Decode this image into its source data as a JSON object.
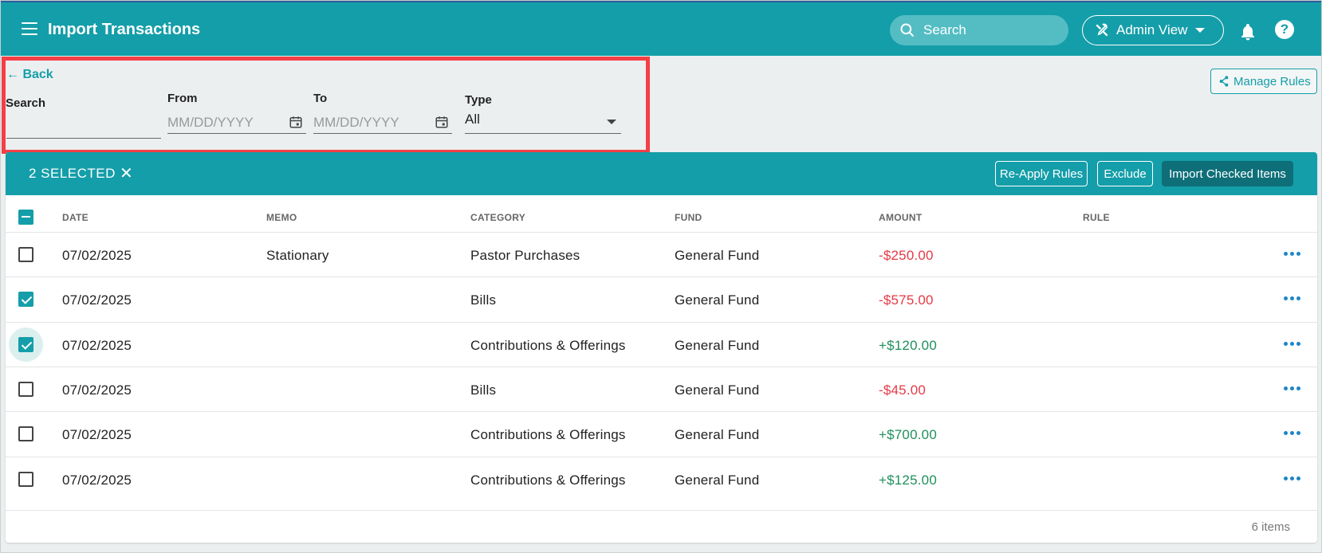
{
  "header": {
    "title": "Import Transactions",
    "search_placeholder": "Search",
    "admin_view_label": "Admin View",
    "help_label": "?",
    "menu_icon": "hamburger-icon",
    "bell_icon": "bell-icon",
    "brand_color": "#149ea9"
  },
  "filters": {
    "back_label": "Back",
    "search_label": "Search",
    "search_value": "",
    "from_label": "From",
    "from_placeholder": "MM/DD/YYYY",
    "to_label": "To",
    "to_placeholder": "MM/DD/YYYY",
    "type_label": "Type",
    "type_value": "All",
    "highlight_color": "#f43f45"
  },
  "manage_rules_label": "Manage Rules",
  "selection_bar": {
    "selected_text": "2 SELECTED",
    "close_glyph": "✕",
    "reapply_label": "Re-Apply Rules",
    "exclude_label": "Exclude",
    "import_label": "Import Checked Items"
  },
  "table": {
    "columns": [
      "DATE",
      "MEMO",
      "CATEGORY",
      "FUND",
      "AMOUNT",
      "RULE"
    ],
    "rows": [
      {
        "date": "07/02/2025",
        "memo": "Stationary",
        "category": "Pastor Purchases",
        "fund": "General Fund",
        "amount": "-$250.00",
        "checked": false
      },
      {
        "date": "07/02/2025",
        "memo": "",
        "category": "Bills",
        "fund": "General Fund",
        "amount": "-$575.00",
        "checked": true
      },
      {
        "date": "07/02/2025",
        "memo": "",
        "category": "Contributions & Offerings",
        "fund": "General Fund",
        "amount": "+$120.00",
        "checked": true
      },
      {
        "date": "07/02/2025",
        "memo": "",
        "category": "Bills",
        "fund": "General Fund",
        "amount": "-$45.00",
        "checked": false
      },
      {
        "date": "07/02/2025",
        "memo": "",
        "category": "Contributions & Offerings",
        "fund": "General Fund",
        "amount": "+$700.00",
        "checked": false
      },
      {
        "date": "07/02/2025",
        "memo": "",
        "category": "Contributions & Offerings",
        "fund": "General Fund",
        "amount": "+$125.00",
        "checked": false
      }
    ],
    "footer_count": "6 items",
    "negative_color": "#e53945",
    "positive_color": "#1f8f5b"
  }
}
